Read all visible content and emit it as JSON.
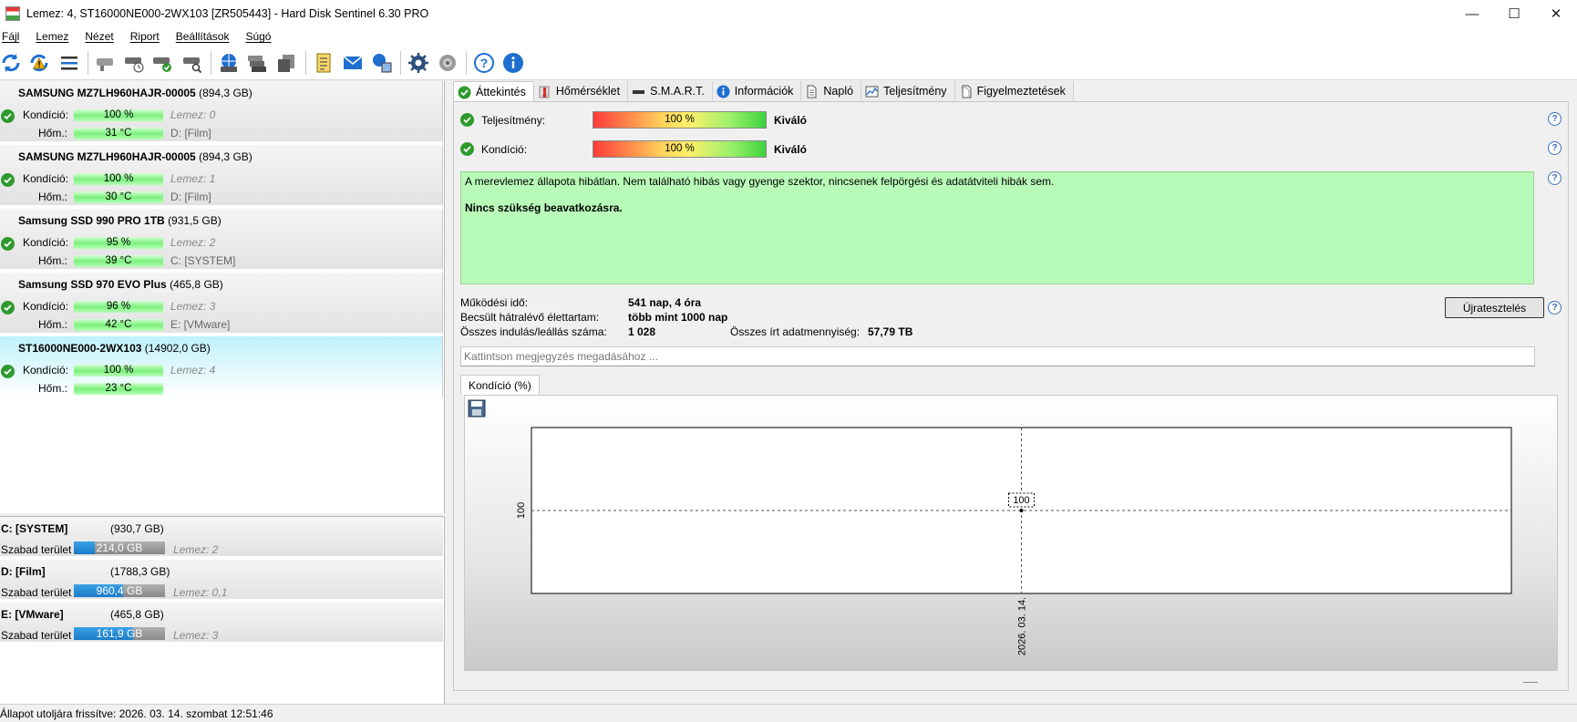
{
  "window": {
    "title": "Lemez: 4, ST16000NE000-2WX103 [ZR505443]  -  Hard Disk Sentinel 6.30 PRO",
    "controls": {
      "minimize": "—",
      "maximize": "☐",
      "close": "✕"
    }
  },
  "menu": [
    "Fájl",
    "Lemez",
    "Nézet",
    "Riport",
    "Beállítások",
    "Súgó"
  ],
  "toolbar_icons": [
    "refresh-icon",
    "refresh-warning-icon",
    "list-icon",
    "disk-gray-icon",
    "disk-clock-icon",
    "disk-check-icon",
    "disk-search-icon",
    "globe-disk-icon",
    "disk-stack-icon",
    "disk-copy-icon",
    "report-icon",
    "mail-icon",
    "network-icon",
    "settings-gear-icon",
    "sound-icon",
    "help-icon",
    "info-icon"
  ],
  "disks": [
    {
      "name": "SAMSUNG MZ7LH960HAJR-00005",
      "size": "(894,3 GB)",
      "condition_label": "Kondíció:",
      "condition": "100 %",
      "temp_label": "Hőm.:",
      "temp": "31 °C",
      "disk_index": "Lemez: 0",
      "partitions": "D: [Film]",
      "selected": false
    },
    {
      "name": "SAMSUNG MZ7LH960HAJR-00005",
      "size": "(894,3 GB)",
      "condition_label": "Kondíció:",
      "condition": "100 %",
      "temp_label": "Hőm.:",
      "temp": "30 °C",
      "disk_index": "Lemez: 1",
      "partitions": "D: [Film]",
      "selected": false
    },
    {
      "name": "Samsung SSD 990 PRO 1TB",
      "size": "(931,5 GB)",
      "condition_label": "Kondíció:",
      "condition": "95 %",
      "temp_label": "Hőm.:",
      "temp": "39 °C",
      "disk_index": "Lemez: 2",
      "partitions": "C: [SYSTEM]",
      "selected": false
    },
    {
      "name": "Samsung SSD 970 EVO Plus",
      "size": "(465,8 GB)",
      "condition_label": "Kondíció:",
      "condition": "96 %",
      "temp_label": "Hőm.:",
      "temp": "42 °C",
      "disk_index": "Lemez: 3",
      "partitions": "E: [VMware]",
      "selected": false
    },
    {
      "name": "ST16000NE000-2WX103",
      "size": "(14902,0 GB)",
      "condition_label": "Kondíció:",
      "condition": "100 %",
      "temp_label": "Hőm.:",
      "temp": "23 °C",
      "disk_index": "Lemez: 4",
      "partitions": "",
      "selected": true
    }
  ],
  "volumes": [
    {
      "name": "C: [SYSTEM]",
      "size": "(930,7 GB)",
      "free_label": "Szabad terület",
      "free": "214,0 GB",
      "free_fraction": 0.23,
      "disk": "Lemez: 2"
    },
    {
      "name": "D: [Film]",
      "size": "(1788,3 GB)",
      "free_label": "Szabad terület",
      "free": "960,4 GB",
      "free_fraction": 0.54,
      "disk": "Lemez: 0,1"
    },
    {
      "name": "E: [VMware]",
      "size": "(465,8 GB)",
      "free_label": "Szabad terület",
      "free": "161,9 GB",
      "free_fraction": 0.65,
      "disk": "Lemez: 3"
    }
  ],
  "tabs": [
    {
      "label": "Áttekintés",
      "icon": "check-circle-icon",
      "active": true
    },
    {
      "label": "Hőmérséklet",
      "icon": "thermometer-icon",
      "active": false
    },
    {
      "label": "S.M.A.R.T.",
      "icon": "drive-icon",
      "active": false
    },
    {
      "label": "Információk",
      "icon": "info-icon",
      "active": false
    },
    {
      "label": "Napló",
      "icon": "log-icon",
      "active": false
    },
    {
      "label": "Teljesítmény",
      "icon": "performance-chart-icon",
      "active": false
    },
    {
      "label": "Figyelmeztetések",
      "icon": "alerts-icon",
      "active": false
    }
  ],
  "overview": {
    "performance_label": "Teljesítmény:",
    "performance_value": "100 %",
    "performance_verdict": "Kiváló",
    "health_label": "Kondíció:",
    "health_value": "100 %",
    "health_verdict": "Kiváló",
    "status_text": "A merevlemez állapota hibátlan. Nem található hibás vagy gyenge szektor, nincsenek felpörgési és adatátviteli hibák sem.",
    "status_advice": "Nincs szükség beavatkozásra.",
    "uptime_label": "Működési idő:",
    "uptime_value": "541 nap, 4 óra",
    "remaining_label": "Becsült hátralévő élettartam:",
    "remaining_value": "több mint 1000 nap",
    "startstop_label": "Összes indulás/leállás száma:",
    "startstop_value": "1 028",
    "written_label": "Összes írt adatmennyiség:",
    "written_value": "57,79 TB",
    "retest_button": "Újratesztelés",
    "note_placeholder": "Kattintson megjegyzés megadásához ...",
    "help_symbol": "?"
  },
  "chart_tab": "Kondíció  (%)",
  "chart_data": {
    "type": "line",
    "title": "",
    "xlabel": "",
    "ylabel": "",
    "x": [
      "2026. 03. 14."
    ],
    "series": [
      {
        "values": [
          100
        ]
      }
    ],
    "y_tick_labels": [
      "100"
    ],
    "data_labels": [
      "100"
    ],
    "grid": true
  },
  "statusbar": "Állapot utoljára frissítve: 2026. 03. 14. szombat 12:51:46",
  "colors": {
    "selected_bg": "#bff0fb",
    "status_green": "#b8fbb8",
    "check_green": "#2e9a2e",
    "volume_blue": "#1a7bc7"
  }
}
